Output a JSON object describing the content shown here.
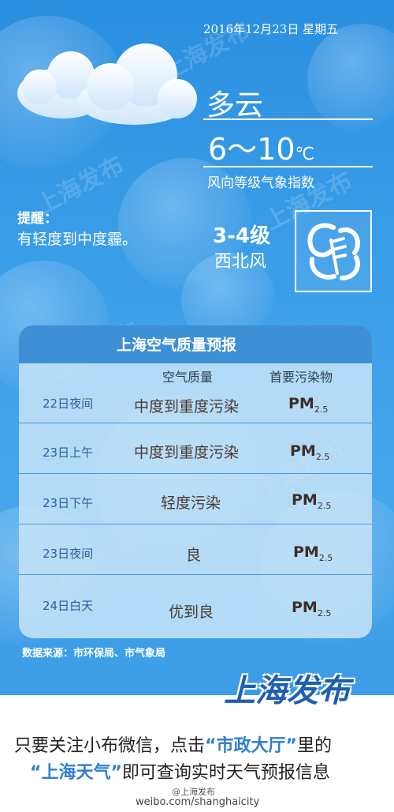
{
  "header": {
    "date": "2016年12月23日  星期五",
    "condition": "多云",
    "temp_range": "6～10",
    "temp_unit": "℃",
    "wind_index_label": "风向等级气象指数"
  },
  "reminder": {
    "title": "提醒：",
    "text": "有轻度到中度霾。"
  },
  "wind": {
    "level": "3-4级",
    "direction": "西北风",
    "icon": "wind-icon"
  },
  "air_quality": {
    "title": "上海空气质量预报",
    "col_quality": "空气质量",
    "col_pollutant": "首要污染物",
    "rows": [
      {
        "period": "22日夜间",
        "quality": "中度到重度污染",
        "pollutant": "PM",
        "pollutant_sub": "2.5"
      },
      {
        "period": "23日上午",
        "quality": "中度到重度污染",
        "pollutant": "PM",
        "pollutant_sub": "2.5"
      },
      {
        "period": "23日下午",
        "quality": "轻度污染",
        "pollutant": "PM",
        "pollutant_sub": "2.5"
      },
      {
        "period": "23日夜间",
        "quality": "良",
        "pollutant": "PM",
        "pollutant_sub": "2.5"
      },
      {
        "period": "24日白天",
        "quality": "优到良",
        "pollutant": "PM",
        "pollutant_sub": "2.5"
      }
    ]
  },
  "source": "数据来源：市环保局、市气象局",
  "brand": "上海发布",
  "watermark": "上海发布",
  "footer": {
    "line1_a": "只要关注小布微信，点击",
    "line1_hl": "“市政大厅”",
    "line1_b": "里的",
    "line2_hl": "“上海天气”",
    "line2_b": "即可查询实时天气预报信息",
    "weibo_name": "@上海发布",
    "weibo_url": "weibo.com/shanghaicity"
  },
  "colors": {
    "sky": "#3a9de8",
    "panel_header": "#3d8fd6",
    "brand": "#1e5fb0",
    "highlight": "#2f7fd0"
  }
}
